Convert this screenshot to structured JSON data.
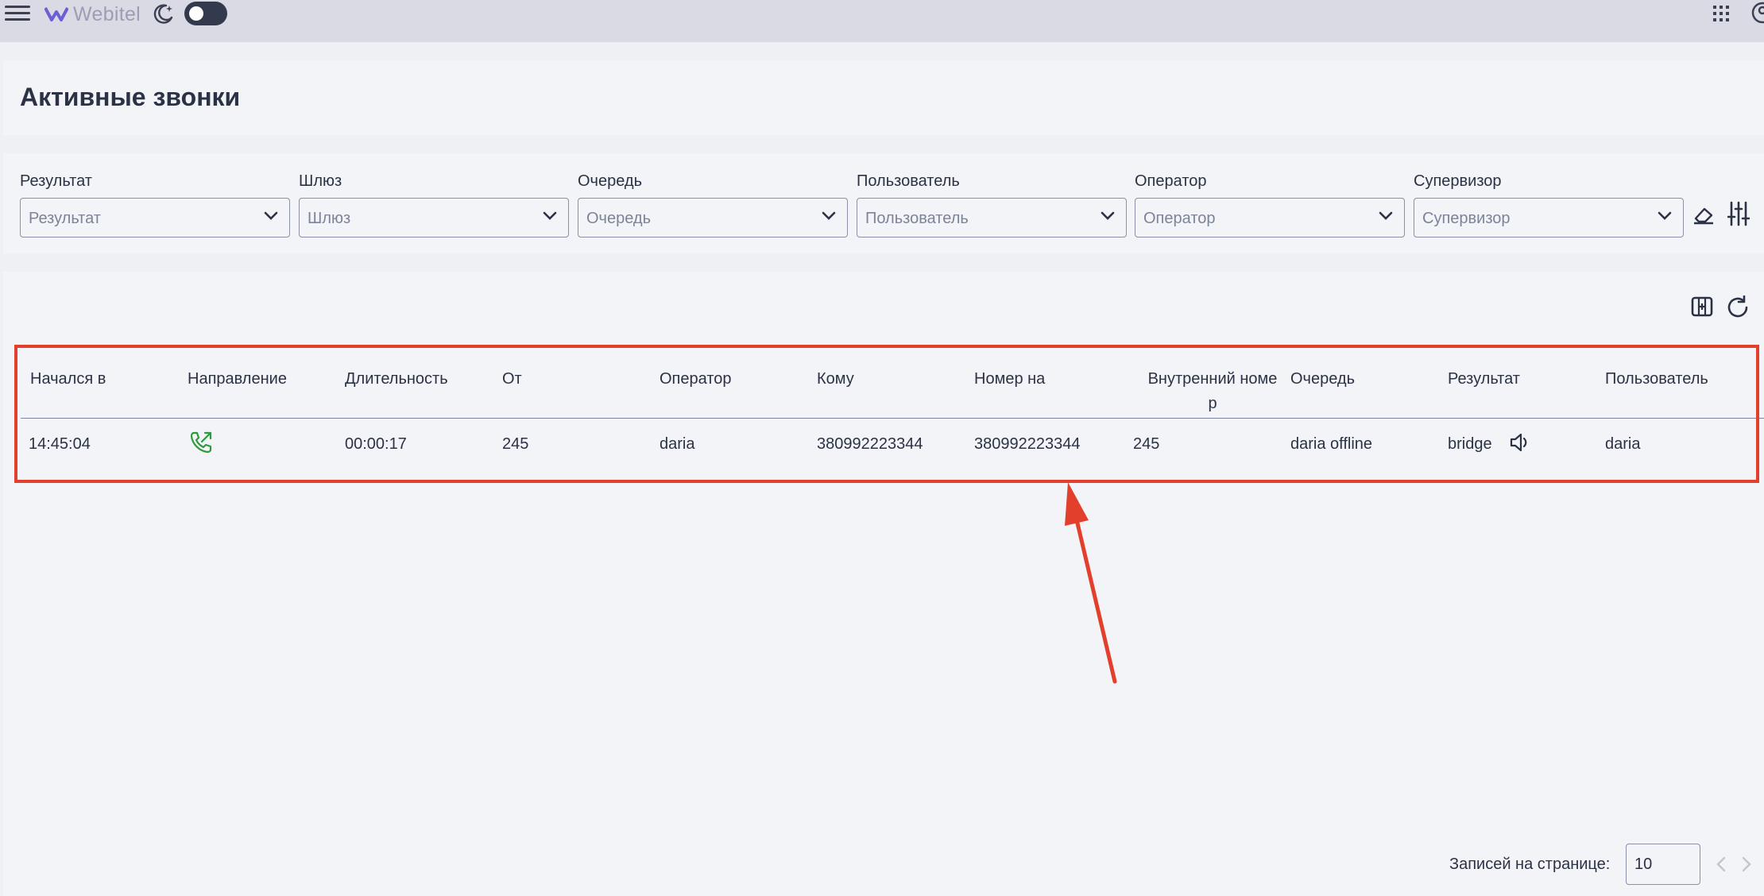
{
  "app": {
    "brand": "Webitel"
  },
  "page": {
    "title": "Активные звонки"
  },
  "filters": [
    {
      "label": "Результат",
      "placeholder": "Результат"
    },
    {
      "label": "Шлюз",
      "placeholder": "Шлюз"
    },
    {
      "label": "Очередь",
      "placeholder": "Очередь"
    },
    {
      "label": "Пользователь",
      "placeholder": "Пользователь"
    },
    {
      "label": "Оператор",
      "placeholder": "Оператор"
    },
    {
      "label": "Супервизор",
      "placeholder": "Супервизор"
    }
  ],
  "table": {
    "headers": [
      "Начался в",
      "Направление",
      "Длительность",
      "От",
      "Оператор",
      "Кому",
      "Номер на",
      "Внутренний номе",
      "Очередь",
      "Результат",
      "Пользователь"
    ],
    "header_wrap": "р",
    "rows": [
      {
        "started": "14:45:04",
        "direction_icon": "outbound-call-icon",
        "duration": "00:00:17",
        "from": "245",
        "operator": "daria",
        "to": "380992223344",
        "number_on": "380992223344",
        "extension": "245",
        "queue": "daria offline",
        "result": "bridge",
        "user": "daria"
      }
    ]
  },
  "pagination": {
    "label": "Записей на странице:",
    "value": "10"
  },
  "colors": {
    "accent_green": "#2e9a3e",
    "highlight_red": "#e2402c",
    "brand_purple": "#6b5fd6"
  }
}
